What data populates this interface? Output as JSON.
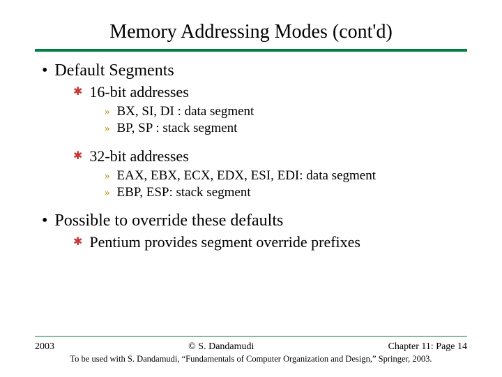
{
  "title": "Memory Addressing Modes (cont'd)",
  "body": {
    "b1a": "Default Segments",
    "b2a": "16-bit addresses",
    "b3a": "BX, SI, DI : data segment",
    "b3b": "BP, SP : stack segment",
    "b2b": "32-bit addresses",
    "b3c": "EAX, EBX, ECX, EDX, ESI, EDI: data segment",
    "b3d": "EBP, ESP: stack segment",
    "b1b": "Possible to override these defaults",
    "b2c": "Pentium provides segment override prefixes"
  },
  "footer": {
    "year": "2003",
    "center": "© S. Dandamudi",
    "right": "Chapter 11: Page 14",
    "cite": "To be used with S. Dandamudi, “Fundamentals of Computer Organization and Design,” Springer, 2003."
  }
}
